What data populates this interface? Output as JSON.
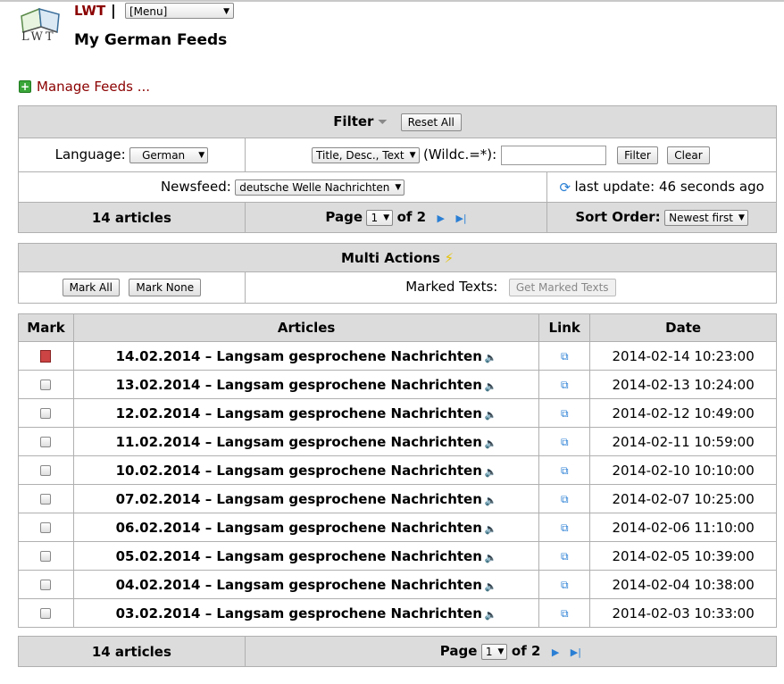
{
  "header": {
    "app_name": "LWT",
    "separator": "|",
    "logo_text": "LWT",
    "menu_value": "[Menu]",
    "page_title": "My German Feeds",
    "manage_feeds": "Manage Feeds ..."
  },
  "filter": {
    "title": "Filter",
    "reset_label": "Reset All",
    "language_label": "Language:",
    "language_value": "German",
    "query_mode_value": "Title, Desc., Text",
    "wildcard_label": "(Wildc.=*):",
    "filter_label": "Filter",
    "clear_label": "Clear",
    "newsfeed_label": "Newsfeed:",
    "newsfeed_value": "deutsche Welle Nachrichten",
    "last_update": "last update: 46 seconds ago",
    "articles_count": "14 articles",
    "page_label": "Page",
    "page_value": "1",
    "page_of": "of 2",
    "sort_label": "Sort Order:",
    "sort_value": "Newest first"
  },
  "multi": {
    "title": "Multi Actions",
    "mark_all": "Mark All",
    "mark_none": "Mark None",
    "marked_texts_label": "Marked Texts:",
    "get_marked": "Get Marked Texts"
  },
  "table": {
    "headers": {
      "mark": "Mark",
      "articles": "Articles",
      "link": "Link",
      "date": "Date"
    },
    "rows": [
      {
        "title": "14.02.2014 – Langsam gesprochene Nachrichten",
        "date": "2014-02-14 10:23:00"
      },
      {
        "title": "13.02.2014 – Langsam gesprochene Nachrichten",
        "date": "2014-02-13 10:24:00"
      },
      {
        "title": "12.02.2014 – Langsam gesprochene Nachrichten",
        "date": "2014-02-12 10:49:00"
      },
      {
        "title": "11.02.2014 – Langsam gesprochene Nachrichten",
        "date": "2014-02-11 10:59:00"
      },
      {
        "title": "10.02.2014 – Langsam gesprochene Nachrichten",
        "date": "2014-02-10 10:10:00"
      },
      {
        "title": "07.02.2014 – Langsam gesprochene Nachrichten",
        "date": "2014-02-07 10:25:00"
      },
      {
        "title": "06.02.2014 – Langsam gesprochene Nachrichten",
        "date": "2014-02-06 11:10:00"
      },
      {
        "title": "05.02.2014 – Langsam gesprochene Nachrichten",
        "date": "2014-02-05 10:39:00"
      },
      {
        "title": "04.02.2014 – Langsam gesprochene Nachrichten",
        "date": "2014-02-04 10:38:00"
      },
      {
        "title": "03.02.2014 – Langsam gesprochene Nachrichten",
        "date": "2014-02-03 10:33:00"
      }
    ]
  },
  "footer": {
    "articles_count": "14 articles",
    "page_label": "Page",
    "page_value": "1",
    "page_of": "of 2"
  }
}
